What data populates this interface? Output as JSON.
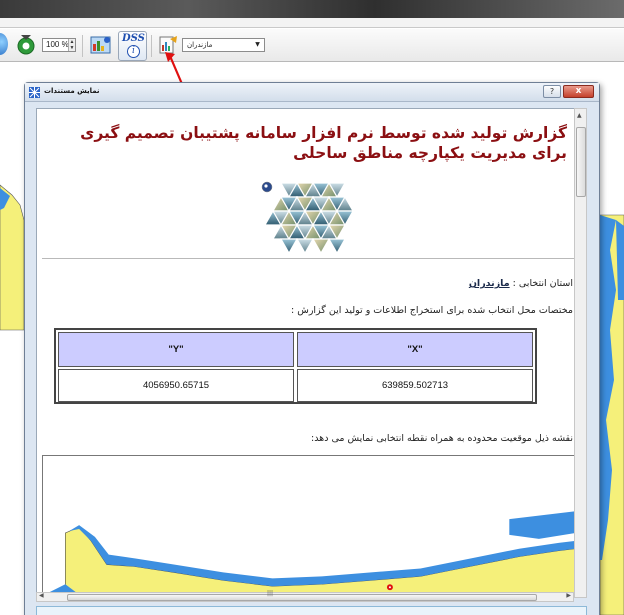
{
  "toolbar": {
    "zoom_value": "100 %",
    "province_selected": "مازندران",
    "icons": [
      "globe-icon",
      "refresh-icon",
      "map-layers-icon",
      "dss-info-icon",
      "report-icon",
      "dropdown-arrow-icon"
    ]
  },
  "dialog": {
    "title": "نمایش مستندات",
    "help_label": "?",
    "close_label": "x"
  },
  "report": {
    "title": "گزارش تولید شده توسط نرم افزار سامانه پشتیبان تصمیم گیری برای مدیریت یکپارچه مناطق ساحلی",
    "province_label": "استان انتخابی :",
    "province_value": "مازندران",
    "coords_text": "مختصات محل انتخاب شده برای استخراج اطلاعات و تولید این گزارش :",
    "table": {
      "headers": [
        "\"X\"",
        "\"Y\""
      ],
      "values": [
        "639859.502713",
        "4056950.65715"
      ]
    },
    "map_caption": "نقشه ذیل موقعیت محدوده به همراه نقطه انتخابی نمایش می دهد:"
  },
  "colors": {
    "title_red": "#8b0f12",
    "table_header": "#ccccff",
    "sea_blue": "#3d8fe0",
    "land_yellow": "#f5f07a"
  }
}
